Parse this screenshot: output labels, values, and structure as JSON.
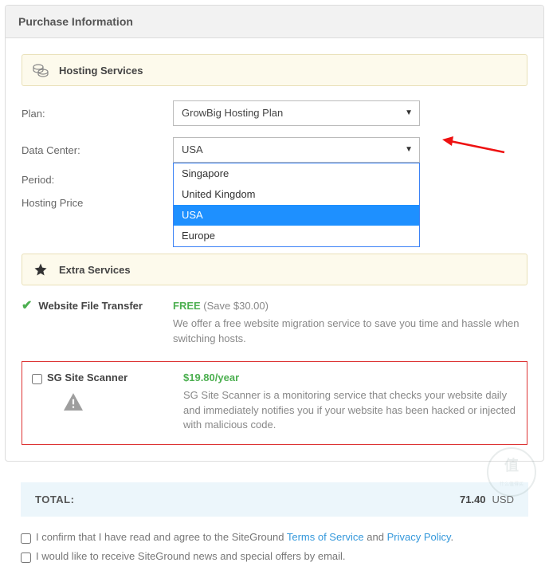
{
  "header": {
    "title": "Purchase Information"
  },
  "hosting": {
    "section_title": "Hosting Services",
    "plan_label": "Plan:",
    "plan_value": "GrowBig Hosting Plan",
    "dc_label": "Data Center:",
    "dc_value": "USA",
    "dc_options": [
      "Singapore",
      "United Kingdom",
      "USA",
      "Europe"
    ],
    "period_label": "Period:",
    "price_label": "Hosting Price"
  },
  "extras": {
    "section_title": "Extra Services",
    "transfer": {
      "title": "Website File Transfer",
      "free": "FREE",
      "save": "(Save $30.00)",
      "desc": "We offer a free website migration service to save you time and hassle when switching hosts."
    },
    "scanner": {
      "title": "SG Site Scanner",
      "price": "$19.80/year",
      "desc": "SG Site Scanner is a monitoring service that checks your website daily and immediately notifies you if your website has been hacked or injected with malicious code."
    }
  },
  "total": {
    "label": "TOTAL:",
    "amount": "71.40",
    "currency": "USD"
  },
  "agree": {
    "confirm_pre": "I confirm that I have read and agree to the SiteGround ",
    "tos": "Terms of Service",
    "and": " and ",
    "pp": "Privacy Policy",
    "dot": ".",
    "news": "I would like to receive SiteGround news and special offers by email."
  },
  "watermark": "什么值得买"
}
